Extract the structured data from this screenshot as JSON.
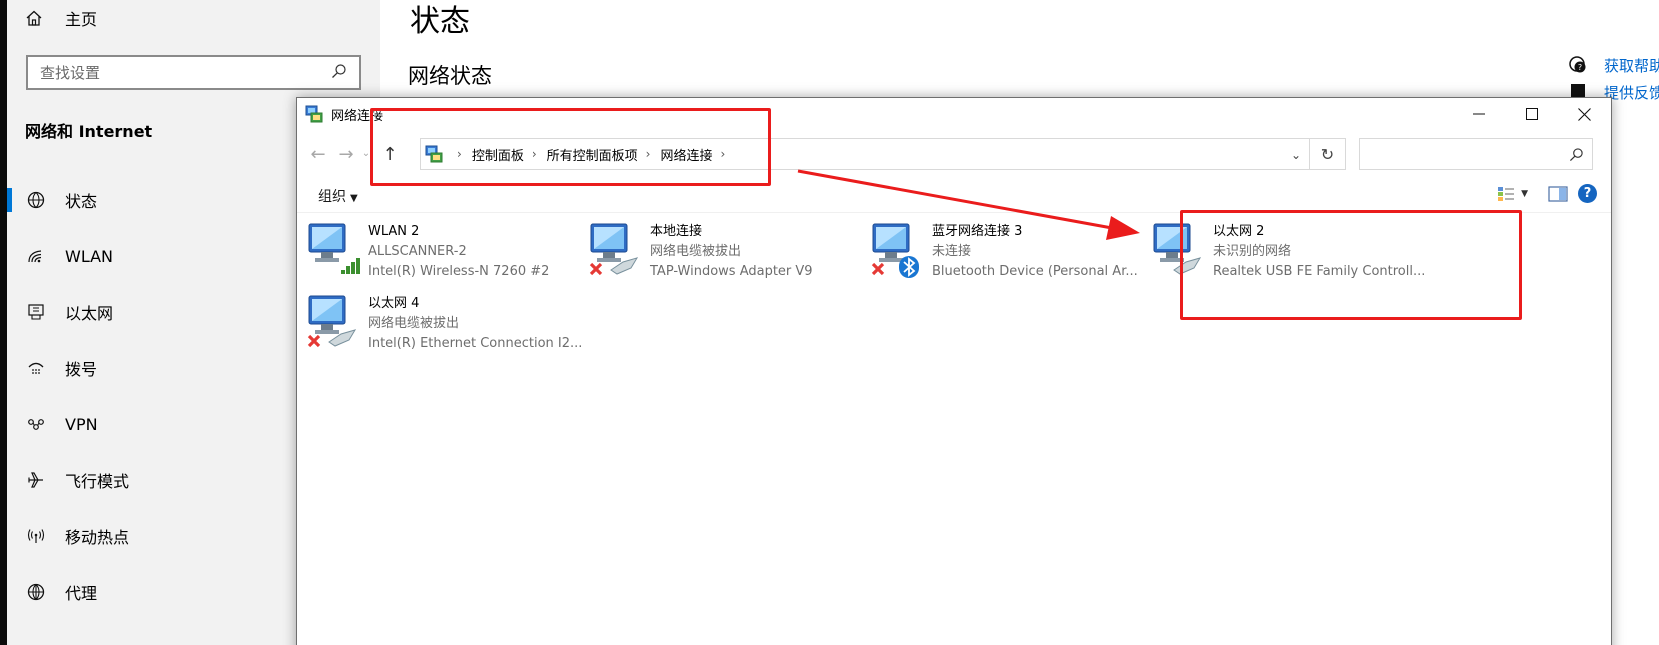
{
  "settings": {
    "home_label": "主页",
    "search_placeholder": "查找设置",
    "section_title": "网络和 Internet",
    "nav_items": [
      {
        "label": "状态",
        "icon": "globe-status-icon",
        "active": true
      },
      {
        "label": "WLAN",
        "icon": "wifi-icon"
      },
      {
        "label": "以太网",
        "icon": "ethernet-icon"
      },
      {
        "label": "拨号",
        "icon": "dialup-icon"
      },
      {
        "label": "VPN",
        "icon": "vpn-icon"
      },
      {
        "label": "飞行模式",
        "icon": "airplane-icon"
      },
      {
        "label": "移动热点",
        "icon": "hotspot-icon"
      },
      {
        "label": "代理",
        "icon": "globe-icon"
      }
    ],
    "page_title": "状态",
    "section_heading": "网络状态",
    "help_links": [
      {
        "label": "获取帮助",
        "icon": "help-chat-icon"
      },
      {
        "label": "提供反馈",
        "icon": "feedback-icon"
      }
    ]
  },
  "explorer": {
    "window_title": "网络连接",
    "breadcrumb": [
      "控制面板",
      "所有控制面板项",
      "网络连接"
    ],
    "organize_label": "组织",
    "help_symbol": "?",
    "connections": [
      {
        "name": "WLAN 2",
        "status": "ALLSCANNER-2",
        "adapter": "Intel(R) Wireless-N 7260 #2",
        "badge": "signal"
      },
      {
        "name": "本地连接",
        "status": "网络电缆被拔出",
        "adapter": "TAP-Windows Adapter V9",
        "badge": "cable-x"
      },
      {
        "name": "蓝牙网络连接 3",
        "status": "未连接",
        "adapter": "Bluetooth Device (Personal Ar...",
        "badge": "bluetooth-x"
      },
      {
        "name": "以太网 2",
        "status": "未识别的网络",
        "adapter": "Realtek USB FE Family Controll...",
        "badge": "cable"
      },
      {
        "name": "以太网 4",
        "status": "网络电缆被拔出",
        "adapter": "Intel(R) Ethernet Connection I2...",
        "badge": "cable-x"
      }
    ]
  },
  "colors": {
    "annotation_red": "#ea1c1c",
    "accent_blue": "#0078d7",
    "link_blue": "#0066cc"
  }
}
